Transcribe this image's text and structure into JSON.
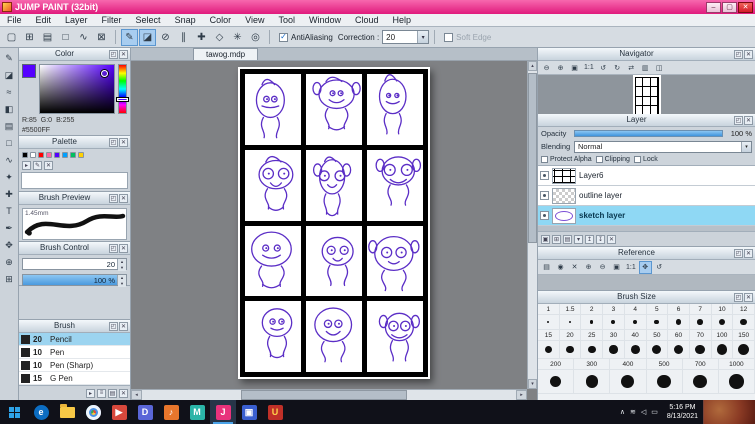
{
  "window": {
    "title": "JUMP PAINT (32bit)"
  },
  "ui_icons": {
    "min": "–",
    "max": "▢",
    "close": "✕",
    "undock": "◰",
    "panel_close": "✕",
    "check": "✓",
    "arrow_down": "▾",
    "spin_up": "▴",
    "spin_down": "▾",
    "scroll_left": "◂",
    "scroll_right": "▸",
    "scroll_up": "▴",
    "scroll_down": "▾"
  },
  "menu": {
    "items": [
      "File",
      "Edit",
      "Layer",
      "Filter",
      "Select",
      "Snap",
      "Color",
      "View",
      "Tool",
      "Window",
      "Cloud",
      "Help"
    ]
  },
  "toolbar": {
    "groups": [
      {
        "buttons": [
          {
            "name": "new-page-icon",
            "glyph": "▢"
          },
          {
            "name": "comic-guide-icon",
            "glyph": "⊞"
          },
          {
            "name": "material-icon",
            "glyph": "▤"
          },
          {
            "name": "select-rect-icon",
            "glyph": "□"
          },
          {
            "name": "select-lasso-icon",
            "glyph": "∿"
          },
          {
            "name": "deselect-icon",
            "glyph": "⊠"
          }
        ]
      },
      {
        "buttons": [
          {
            "name": "pen-icon",
            "glyph": "✎",
            "active": true
          },
          {
            "name": "eraser-icon",
            "glyph": "◪",
            "active": true
          },
          {
            "name": "snap-off-icon",
            "glyph": "⊘"
          },
          {
            "name": "snap-parallel-icon",
            "glyph": "∥"
          },
          {
            "name": "snap-cross-icon",
            "glyph": "✚"
          },
          {
            "name": "snap-vanishing-icon",
            "glyph": "◇"
          },
          {
            "name": "snap-radial-icon",
            "glyph": "✳"
          },
          {
            "name": "snap-ellipse-icon",
            "glyph": "◎"
          }
        ]
      }
    ],
    "antialiasing_label": "AntiAliasing",
    "correction_label": "Correction :",
    "correction_value": "20",
    "soft_edge_label": "Soft Edge"
  },
  "tools": {
    "items": [
      {
        "name": "brush-tool-icon",
        "glyph": "✎"
      },
      {
        "name": "eraser-tool-icon",
        "glyph": "◪"
      },
      {
        "name": "airbrush-tool-icon",
        "glyph": "≈"
      },
      {
        "name": "fill-tool-icon",
        "glyph": "◧"
      },
      {
        "name": "gradient-tool-icon",
        "glyph": "▤"
      },
      {
        "name": "select-rect-tool-icon",
        "glyph": "□"
      },
      {
        "name": "lasso-tool-icon",
        "glyph": "∿"
      },
      {
        "name": "magic-wand-tool-icon",
        "glyph": "✦"
      },
      {
        "name": "move-tool-icon",
        "glyph": "✚"
      },
      {
        "name": "text-tool-icon",
        "glyph": "T"
      },
      {
        "name": "eyedropper-tool-icon",
        "glyph": "✒"
      },
      {
        "name": "hand-tool-icon",
        "glyph": "✥"
      },
      {
        "name": "zoom-tool-icon",
        "glyph": "⊕"
      },
      {
        "name": "panel-divide-tool-icon",
        "glyph": "⊞"
      }
    ]
  },
  "color_panel": {
    "title": "Color",
    "current_hex": "#5500FF",
    "r_label": "R:85",
    "g_label": "G:0",
    "b_label": "B:255",
    "hex_label": "#5500FF"
  },
  "palette_panel": {
    "title": "Palette",
    "colors": [
      "#000000",
      "#ffffff",
      "#ff0000",
      "#ff66a0",
      "#5500ff",
      "#00a0ff",
      "#00c060",
      "#ffd000"
    ],
    "tool_icons": [
      {
        "name": "add-color-icon",
        "glyph": "▸"
      },
      {
        "name": "edit-color-icon",
        "glyph": "✎"
      },
      {
        "name": "delete-color-icon",
        "glyph": "✕"
      }
    ]
  },
  "brush_preview_panel": {
    "title": "Brush Preview",
    "size_label": "1.45mm"
  },
  "brush_control_panel": {
    "title": "Brush Control",
    "size_value": "20",
    "opacity_value": "100 %"
  },
  "brush_panel": {
    "title": "Brush",
    "items": [
      {
        "size": "20",
        "name": "Pencil",
        "selected": true
      },
      {
        "size": "10",
        "name": "Pen"
      },
      {
        "size": "10",
        "name": "Pen (Sharp)"
      },
      {
        "size": "15",
        "name": "G Pen"
      }
    ],
    "tool_icons": [
      {
        "name": "add-brush-icon",
        "glyph": "▸"
      },
      {
        "name": "brush-menu-icon",
        "glyph": "≡"
      },
      {
        "name": "brush-folder-icon",
        "glyph": "▤"
      },
      {
        "name": "delete-brush-icon",
        "glyph": "✕"
      }
    ]
  },
  "canvas": {
    "tab_label": "tawog.mdp",
    "rows": 4,
    "columns": 3,
    "panel_count": 12,
    "ink_color": "#5b2ec6"
  },
  "navigator_panel": {
    "title": "Navigator",
    "buttons": [
      {
        "name": "zoom-out-icon",
        "glyph": "⊖"
      },
      {
        "name": "zoom-in-icon",
        "glyph": "⊕"
      },
      {
        "name": "fit-screen-icon",
        "glyph": "▣"
      },
      {
        "name": "actual-size-icon",
        "glyph": "1:1"
      },
      {
        "name": "rotate-left-icon",
        "glyph": "↺"
      },
      {
        "name": "rotate-right-icon",
        "glyph": "↻"
      },
      {
        "name": "flip-horizontal-icon",
        "glyph": "⇄"
      },
      {
        "name": "spread-view-icon",
        "glyph": "▥"
      },
      {
        "name": "page-view-icon",
        "glyph": "◫"
      }
    ]
  },
  "layer_panel": {
    "title": "Layer",
    "opacity_label": "Opacity",
    "opacity_value": "100 %",
    "blending_label": "Blending",
    "blending_value": "Normal",
    "checks": [
      "Protect Alpha",
      "Clipping",
      "Lock"
    ],
    "layers": [
      {
        "name": "Layer6",
        "thumb": "grid"
      },
      {
        "name": "outline layer",
        "thumb": "checker"
      },
      {
        "name": "sketch layer",
        "thumb": "sketch",
        "selected": true
      }
    ],
    "tool_icons": [
      {
        "name": "add-layer-icon",
        "glyph": "▣"
      },
      {
        "name": "duplicate-layer-icon",
        "glyph": "⊞"
      },
      {
        "name": "layer-folder-icon",
        "glyph": "▤"
      },
      {
        "name": "merge-down-icon",
        "glyph": "▾"
      },
      {
        "name": "move-layer-up-icon",
        "glyph": "↥"
      },
      {
        "name": "move-layer-down-icon",
        "glyph": "↧"
      },
      {
        "name": "delete-layer-icon",
        "glyph": "✕"
      }
    ]
  },
  "reference_panel": {
    "title": "Reference",
    "buttons": [
      {
        "name": "open-reference-icon",
        "glyph": "▤"
      },
      {
        "name": "capture-icon",
        "glyph": "◉"
      },
      {
        "name": "clear-reference-icon",
        "glyph": "✕"
      },
      {
        "name": "zoom-in-icon",
        "glyph": "⊕"
      },
      {
        "name": "zoom-out-icon",
        "glyph": "⊖"
      },
      {
        "name": "fit-icon",
        "glyph": "▣"
      },
      {
        "name": "actual-icon",
        "glyph": "1:1"
      },
      {
        "name": "hand-icon",
        "glyph": "✥",
        "active": true
      },
      {
        "name": "rotate-icon",
        "glyph": "↺"
      }
    ]
  },
  "brush_size_panel": {
    "title": "Brush Size",
    "sizes": [
      1,
      1.5,
      2,
      3,
      4,
      5,
      6,
      7,
      10,
      12,
      15,
      20,
      25,
      30,
      40,
      50,
      60,
      70,
      100,
      150,
      200,
      300,
      400,
      500,
      700,
      1000
    ]
  },
  "taskbar": {
    "apps": [
      {
        "name": "taskbar-edge-icon",
        "glyph": "e",
        "bg": "#0c6dc2",
        "round": true
      },
      {
        "name": "taskbar-explorer-icon",
        "glyph": "",
        "bg": "folder"
      },
      {
        "name": "taskbar-chrome-icon",
        "glyph": "",
        "bg": "conic",
        "round": true
      },
      {
        "name": "taskbar-media-icon",
        "glyph": "▶",
        "bg": "#d8483c"
      },
      {
        "name": "taskbar-chat-icon",
        "glyph": "D",
        "bg": "#5a66d8"
      },
      {
        "name": "taskbar-music-icon",
        "glyph": "♪",
        "bg": "#e8762c"
      },
      {
        "name": "taskbar-medibang-icon",
        "glyph": "M",
        "bg": "#2bb5a8"
      },
      {
        "name": "taskbar-jumppaint-icon",
        "glyph": "J",
        "bg": "#e8327c",
        "active": true
      },
      {
        "name": "taskbar-video-icon",
        "glyph": "▣",
        "bg": "#3a5fd0"
      },
      {
        "name": "taskbar-game-icon",
        "glyph": "U",
        "bg": "#c03028",
        "fg": "#ffd24a"
      }
    ],
    "tray": [
      {
        "name": "tray-expand-icon",
        "glyph": "∧"
      },
      {
        "name": "tray-network-icon",
        "glyph": "≋"
      },
      {
        "name": "tray-volume-icon",
        "glyph": "◁"
      },
      {
        "name": "tray-notification-icon",
        "glyph": "▭"
      }
    ],
    "time": "5:16 PM",
    "date": "8/13/2021"
  }
}
